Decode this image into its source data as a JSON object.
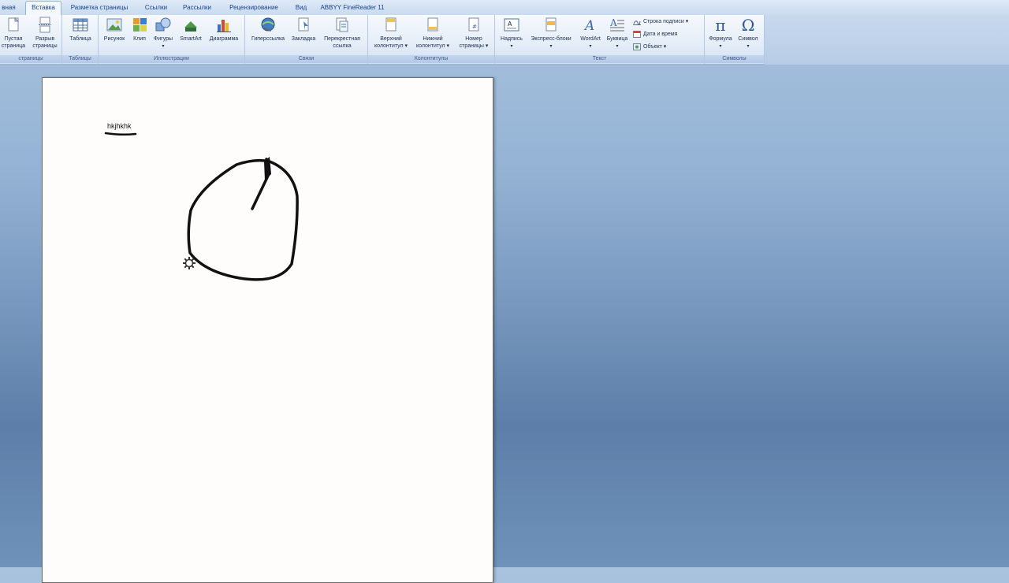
{
  "tabs": [
    {
      "label": "вная"
    },
    {
      "label": "Вставка"
    },
    {
      "label": "Разметка страницы"
    },
    {
      "label": "Ссылки"
    },
    {
      "label": "Рассылки"
    },
    {
      "label": "Рецензирование"
    },
    {
      "label": "Вид"
    },
    {
      "label": "ABBYY FineReader 11"
    }
  ],
  "ribbon": {
    "pages": {
      "label": "страницы",
      "items": [
        {
          "line1": "Пустая",
          "line2": "страница",
          "icon": "blank-page-icon"
        },
        {
          "line1": "Разрыв",
          "line2": "страницы",
          "icon": "page-break-icon"
        }
      ]
    },
    "tables": {
      "label": "Таблицы",
      "items": [
        {
          "line1": "Таблица",
          "icon": "table-icon"
        }
      ]
    },
    "illustrations": {
      "label": "Иллюстрации",
      "items": [
        {
          "line1": "Рисунок",
          "icon": "picture-icon"
        },
        {
          "line1": "Клип",
          "icon": "clip-art-icon"
        },
        {
          "line1": "Фигуры",
          "icon": "shapes-icon"
        },
        {
          "line1": "SmartArt",
          "icon": "smartart-icon"
        },
        {
          "line1": "Диаграмма",
          "icon": "chart-icon"
        }
      ]
    },
    "links": {
      "label": "Связи",
      "items": [
        {
          "line1": "Гиперссылка",
          "icon": "hyperlink-icon"
        },
        {
          "line1": "Закладка",
          "icon": "bookmark-icon"
        },
        {
          "line1": "Перекрестная",
          "line2": "ссылка",
          "icon": "cross-reference-icon"
        }
      ]
    },
    "headers": {
      "label": "Колонтитулы",
      "items": [
        {
          "line1": "Верхний",
          "line2": "колонтитул ▾",
          "icon": "header-icon"
        },
        {
          "line1": "Нижний",
          "line2": "колонтитул ▾",
          "icon": "footer-icon"
        },
        {
          "line1": "Номер",
          "line2": "страницы ▾",
          "icon": "page-number-icon"
        }
      ]
    },
    "text": {
      "label": "Текст",
      "items": [
        {
          "line1": "Надпись",
          "icon": "text-box-icon"
        },
        {
          "line1": "Экспресс-блоки",
          "icon": "quick-parts-icon"
        },
        {
          "line1": "WordArt",
          "icon": "wordart-icon"
        },
        {
          "line1": "Буквица",
          "icon": "drop-cap-icon"
        }
      ],
      "small": [
        {
          "label": "Строка подписи ▾",
          "icon": "signature-line-icon"
        },
        {
          "label": "Дата и время",
          "icon": "date-time-icon"
        },
        {
          "label": "Объект ▾",
          "icon": "object-icon"
        }
      ]
    },
    "symbols": {
      "label": "Символы",
      "items": [
        {
          "line1": "Формула",
          "icon": "equation-icon",
          "glyph": "π"
        },
        {
          "line1": "Символ",
          "icon": "symbol-icon",
          "glyph": "Ω"
        }
      ]
    }
  },
  "document": {
    "text": "hkjhkhk"
  },
  "colors": {
    "ribbon_text": "#1b2f4f",
    "tab_text": "#15428b",
    "ink": "#111111"
  }
}
